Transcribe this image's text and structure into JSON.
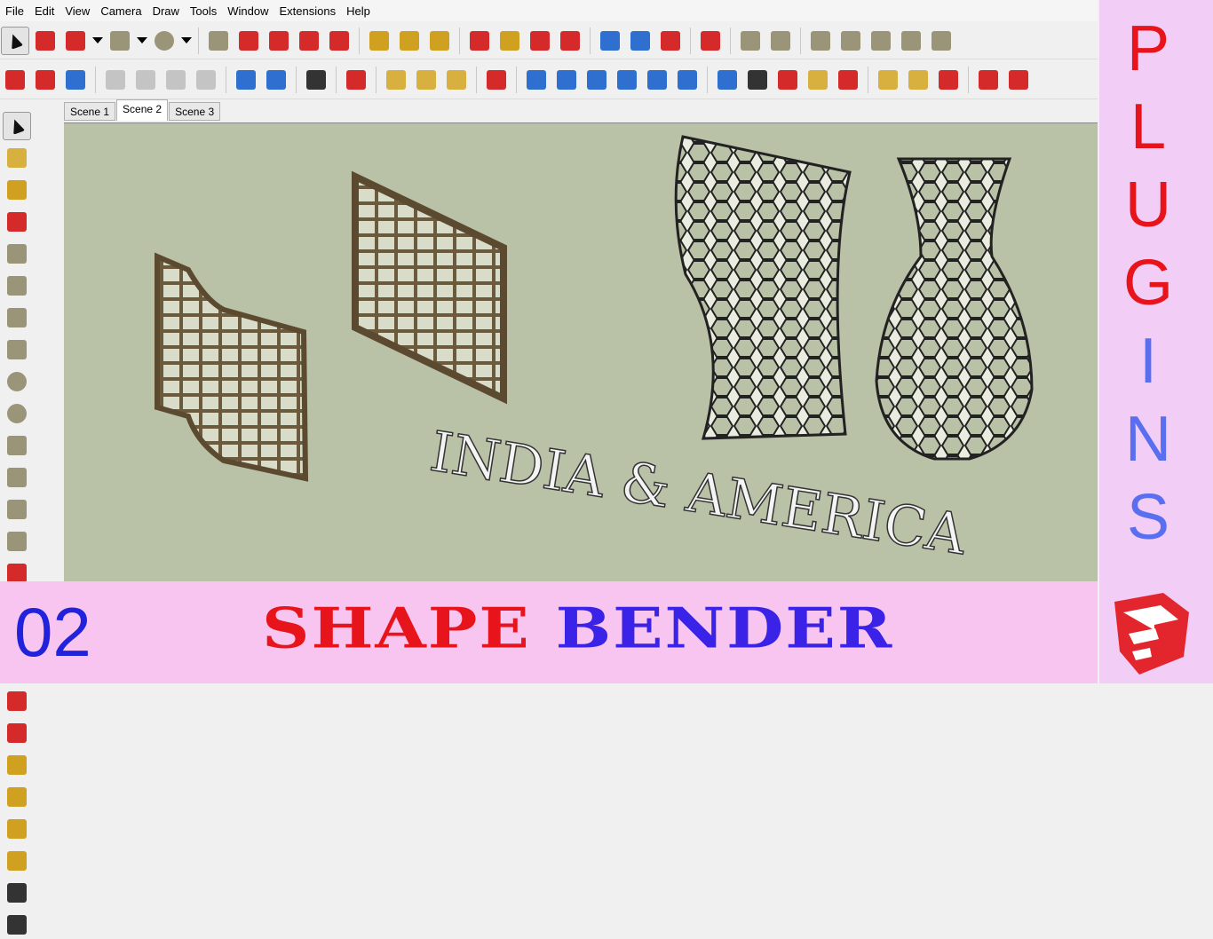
{
  "menu": [
    "File",
    "Edit",
    "View",
    "Camera",
    "Draw",
    "Tools",
    "Window",
    "Extensions",
    "Help"
  ],
  "toolbar_row1": [
    "select",
    "eraser",
    "pencil",
    "dropdown",
    "rectangle",
    "dropdown",
    "circle",
    "dropdown",
    "|",
    "push-pull",
    "follow-me",
    "move",
    "rotate",
    "scale",
    "|",
    "tape-measure",
    "text",
    "paint-bucket",
    "|",
    "orbit",
    "pan",
    "zoom",
    "zoom-extents",
    "|",
    "warehouse",
    "extension-warehouse",
    "share-model",
    "|",
    "ruby",
    "|",
    "sandbox-1",
    "sandbox-2",
    "|",
    "sandbox-3",
    "sandbox-4",
    "sandbox-5",
    "sandbox-6",
    "sandbox-7"
  ],
  "toolbar_row2": [
    "new",
    "open",
    "save",
    "|",
    "cut",
    "copy",
    "paste",
    "erase",
    "|",
    "undo",
    "redo",
    "|",
    "print",
    "|",
    "model-info",
    "|",
    "iso-view",
    "top-view",
    "front-view",
    "|",
    "section-plane",
    "|",
    "house-1",
    "house-2",
    "house-3",
    "house-4",
    "house-5",
    "house-6",
    "|",
    "camera",
    "animation",
    "settings",
    "components",
    "plugin-r",
    "|",
    "layers",
    "styles",
    "arrow-down",
    "|",
    "ruby-2",
    "misc"
  ],
  "left_toolbar": [
    "select",
    "component",
    "paint-bucket",
    "eraser",
    "line",
    "freehand",
    "rectangle",
    "rotated-rectangle",
    "circle",
    "polygon",
    "arc",
    "2-point-arc",
    "3-point-arc",
    "pie",
    "move",
    "push-pull",
    "rotate",
    "follow-me",
    "scale",
    "offset",
    "tape-measure",
    "dimension",
    "protractor",
    "text",
    "axes",
    "3d-text"
  ],
  "tabs": [
    "Scene 1",
    "Scene 2",
    "Scene 3"
  ],
  "active_tab": 1,
  "scene_text": "INDIA & AMERICA",
  "banner": {
    "number": "02",
    "title_word1": "SHAPE",
    "title_word2": "BENDER"
  },
  "side_letters": [
    "P",
    "L",
    "U",
    "G",
    "I",
    "N",
    "S"
  ],
  "colors": {
    "red": "#e8141c",
    "blue": "#3a22e6",
    "side_blue": "#5a6ef0",
    "viewport": "#b9c2a6"
  }
}
